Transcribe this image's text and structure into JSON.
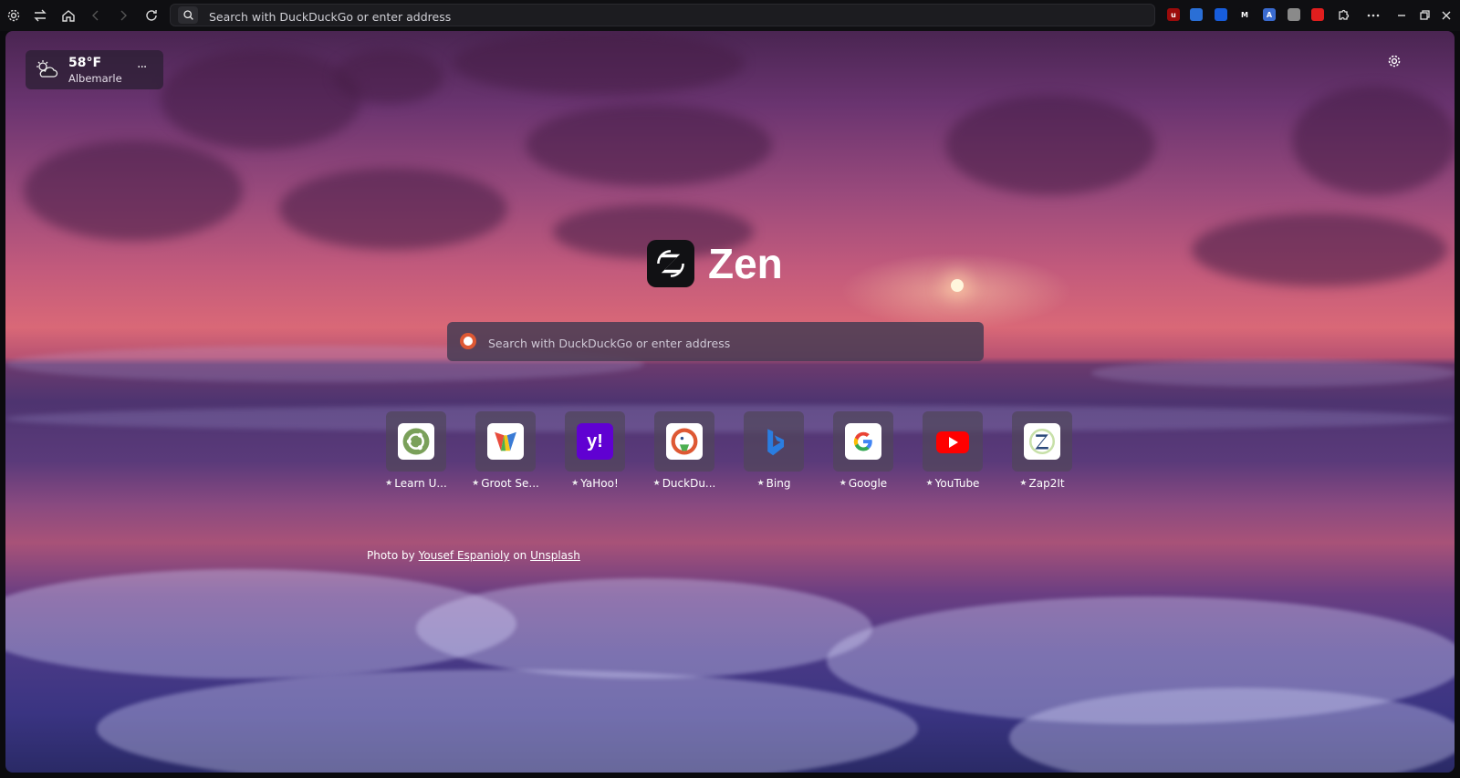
{
  "toolbar": {
    "url_placeholder": "Search with DuckDuckGo or enter address",
    "extensions": [
      {
        "name": "ublock",
        "color": "#9b0b0b",
        "glyph": "u"
      },
      {
        "name": "ext-blue1",
        "color": "#2a6fd6",
        "glyph": ""
      },
      {
        "name": "bitwarden",
        "color": "#175ddc",
        "glyph": ""
      },
      {
        "name": "malwarebytes",
        "color": "#0f0f12",
        "glyph": "M"
      },
      {
        "name": "translate",
        "color": "#3a6bd0",
        "glyph": "A"
      },
      {
        "name": "ext-grey",
        "color": "#8a8a8a",
        "glyph": ""
      },
      {
        "name": "youtube-ext",
        "color": "#e01e1e",
        "glyph": ""
      }
    ]
  },
  "weather": {
    "temperature": "58°F",
    "location": "Albemarle"
  },
  "brand": {
    "name": "Zen"
  },
  "search": {
    "placeholder": "Search with DuckDuckGo or enter address"
  },
  "shortcuts": [
    {
      "label": "Learn U...",
      "icon": "ubuntu-icon",
      "color": "#7aa05a"
    },
    {
      "label": "Groot Se...",
      "icon": "groot-icon",
      "color": "#ffffff"
    },
    {
      "label": "YaHoo!",
      "icon": "yahoo-icon",
      "color": "#6001d2"
    },
    {
      "label": "DuckDu...",
      "icon": "duckduckgo-icon",
      "color": "#de5833"
    },
    {
      "label": "Bing",
      "icon": "bing-icon",
      "color": "#2a7de1"
    },
    {
      "label": "Google",
      "icon": "google-icon",
      "color": "#ffffff"
    },
    {
      "label": "YouTube",
      "icon": "youtube-icon",
      "color": "#ff0000"
    },
    {
      "label": "Zap2It",
      "icon": "zap2it-icon",
      "color": "#ffffff"
    }
  ],
  "credit": {
    "prefix": "Photo by",
    "author": "Yousef Espanioly",
    "middle": "on",
    "site": "Unsplash"
  }
}
